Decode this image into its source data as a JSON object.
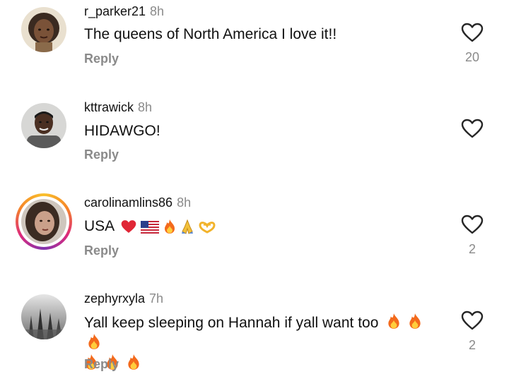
{
  "comments": [
    {
      "username": "r_parker21",
      "time": "8h",
      "text": "The queens of North America I love it!!",
      "reply_label": "Reply",
      "like_icon": "heart-outline-icon",
      "likes": "20"
    },
    {
      "username": "kttrawick",
      "time": "8h",
      "text": "HIDAWGO!",
      "reply_label": "Reply",
      "like_icon": "heart-outline-icon",
      "likes": ""
    },
    {
      "username": "carolinamlins86",
      "time": "8h",
      "text": "USA",
      "emoji": [
        "red-heart",
        "us-flag",
        "fire",
        "folded-hands",
        "heart-hands"
      ],
      "reply_label": "Reply",
      "like_icon": "heart-outline-icon",
      "likes": "2",
      "has_story_ring": true
    },
    {
      "username": "zephyrxyla",
      "time": "7h",
      "text": "Yall keep sleeping on Hannah if yall want too",
      "emoji": [
        "fire",
        "fire",
        "fire",
        "fire",
        "fire",
        "fire"
      ],
      "reply_label": "Reply",
      "like_icon": "heart-outline-icon",
      "likes": "2"
    }
  ],
  "colors": {
    "text_primary": "#111111",
    "text_secondary": "#8a8a8a",
    "story_ring": [
      "#f9c02b",
      "#f58529",
      "#dd2a7b",
      "#8134af"
    ]
  }
}
